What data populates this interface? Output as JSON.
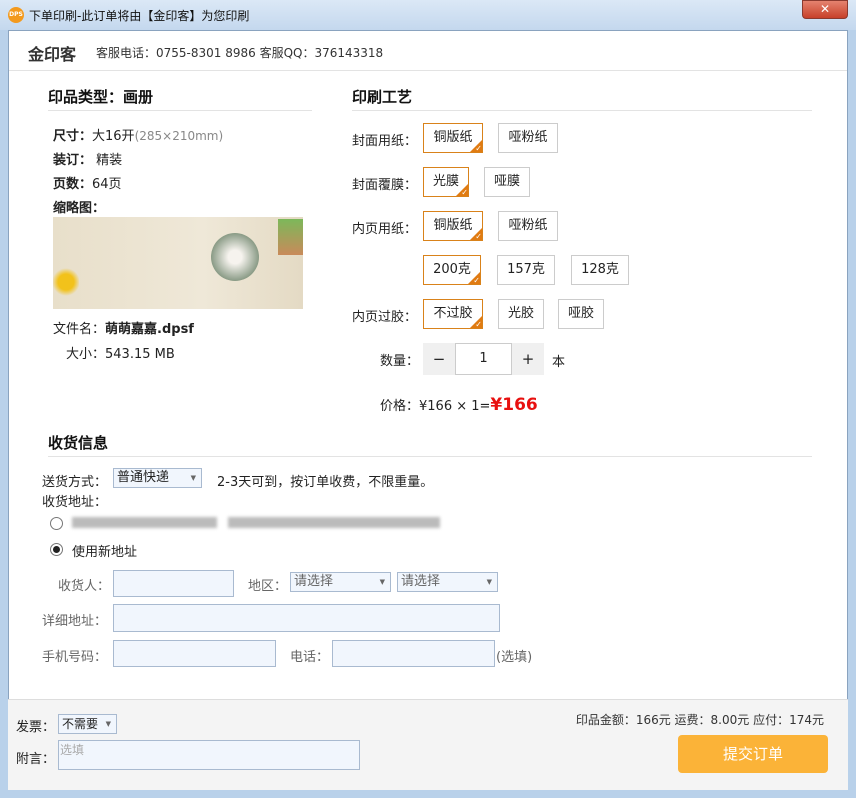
{
  "window": {
    "title": "下单印刷-此订单将由【金印客】为您印刷",
    "icon": "DPS",
    "close": "✕"
  },
  "header": {
    "brand": "金印客",
    "contact": "客服电话：0755-8301 8986 客服QQ：376143318"
  },
  "product": {
    "heading": "印品类型：画册",
    "size_label": "尺寸：",
    "size_value": "大16开",
    "size_dim": "(285×210mm)",
    "binding_label": "装订：",
    "binding_value": " 精装",
    "pages_label": "页数：",
    "pages_value": "64页",
    "thumb_label": "缩略图：",
    "file_label": "文件名：",
    "file_value": "萌萌嘉嘉.dpsf",
    "filesize_label": "大小：",
    "filesize_value": "543.15 MB"
  },
  "craft": {
    "heading": "印刷工艺",
    "cover_paper": {
      "label": "封面用纸：",
      "options": [
        "铜版纸",
        "哑粉纸"
      ],
      "selected": 0
    },
    "cover_film": {
      "label": "封面覆膜：",
      "options": [
        "光膜",
        "哑膜"
      ],
      "selected": 0
    },
    "inner_paper": {
      "label": "内页用纸：",
      "options": [
        "铜版纸",
        "哑粉纸"
      ],
      "selected": 0
    },
    "weight": {
      "options": [
        "200克",
        "157克",
        "128克"
      ],
      "selected": 0
    },
    "inner_glue": {
      "label": "内页过胶：",
      "options": [
        "不过胶",
        "光胶",
        "哑胶"
      ],
      "selected": 0
    },
    "qty_label": "数量：",
    "qty": "1",
    "minus": "−",
    "plus": "+",
    "unit": "本",
    "price_label": "价格：",
    "price_formula": "¥166 × 1=",
    "price_total": "¥166"
  },
  "shipping": {
    "heading": "收货信息",
    "method_label": "送货方式：",
    "method_value": "普通快递",
    "method_desc": "2-3天可到，按订单收费，不限重量。",
    "address_label": "收货地址：",
    "new_address": "使用新地址",
    "receiver_label": "收货人：",
    "region_label": "地区：",
    "region_placeholder1": "请选择",
    "region_placeholder2": "请选择",
    "detail_label": "详细地址：",
    "mobile_label": "手机号码：",
    "phone_label": "电话：",
    "optional": "(选填)"
  },
  "footer": {
    "invoice_label": "发票：",
    "invoice_value": "不需要",
    "note_label": "附言：",
    "note_placeholder": "选填",
    "summary": "印品金额：166元 运费：8.00元 应付：174元",
    "submit": "提交订单"
  }
}
